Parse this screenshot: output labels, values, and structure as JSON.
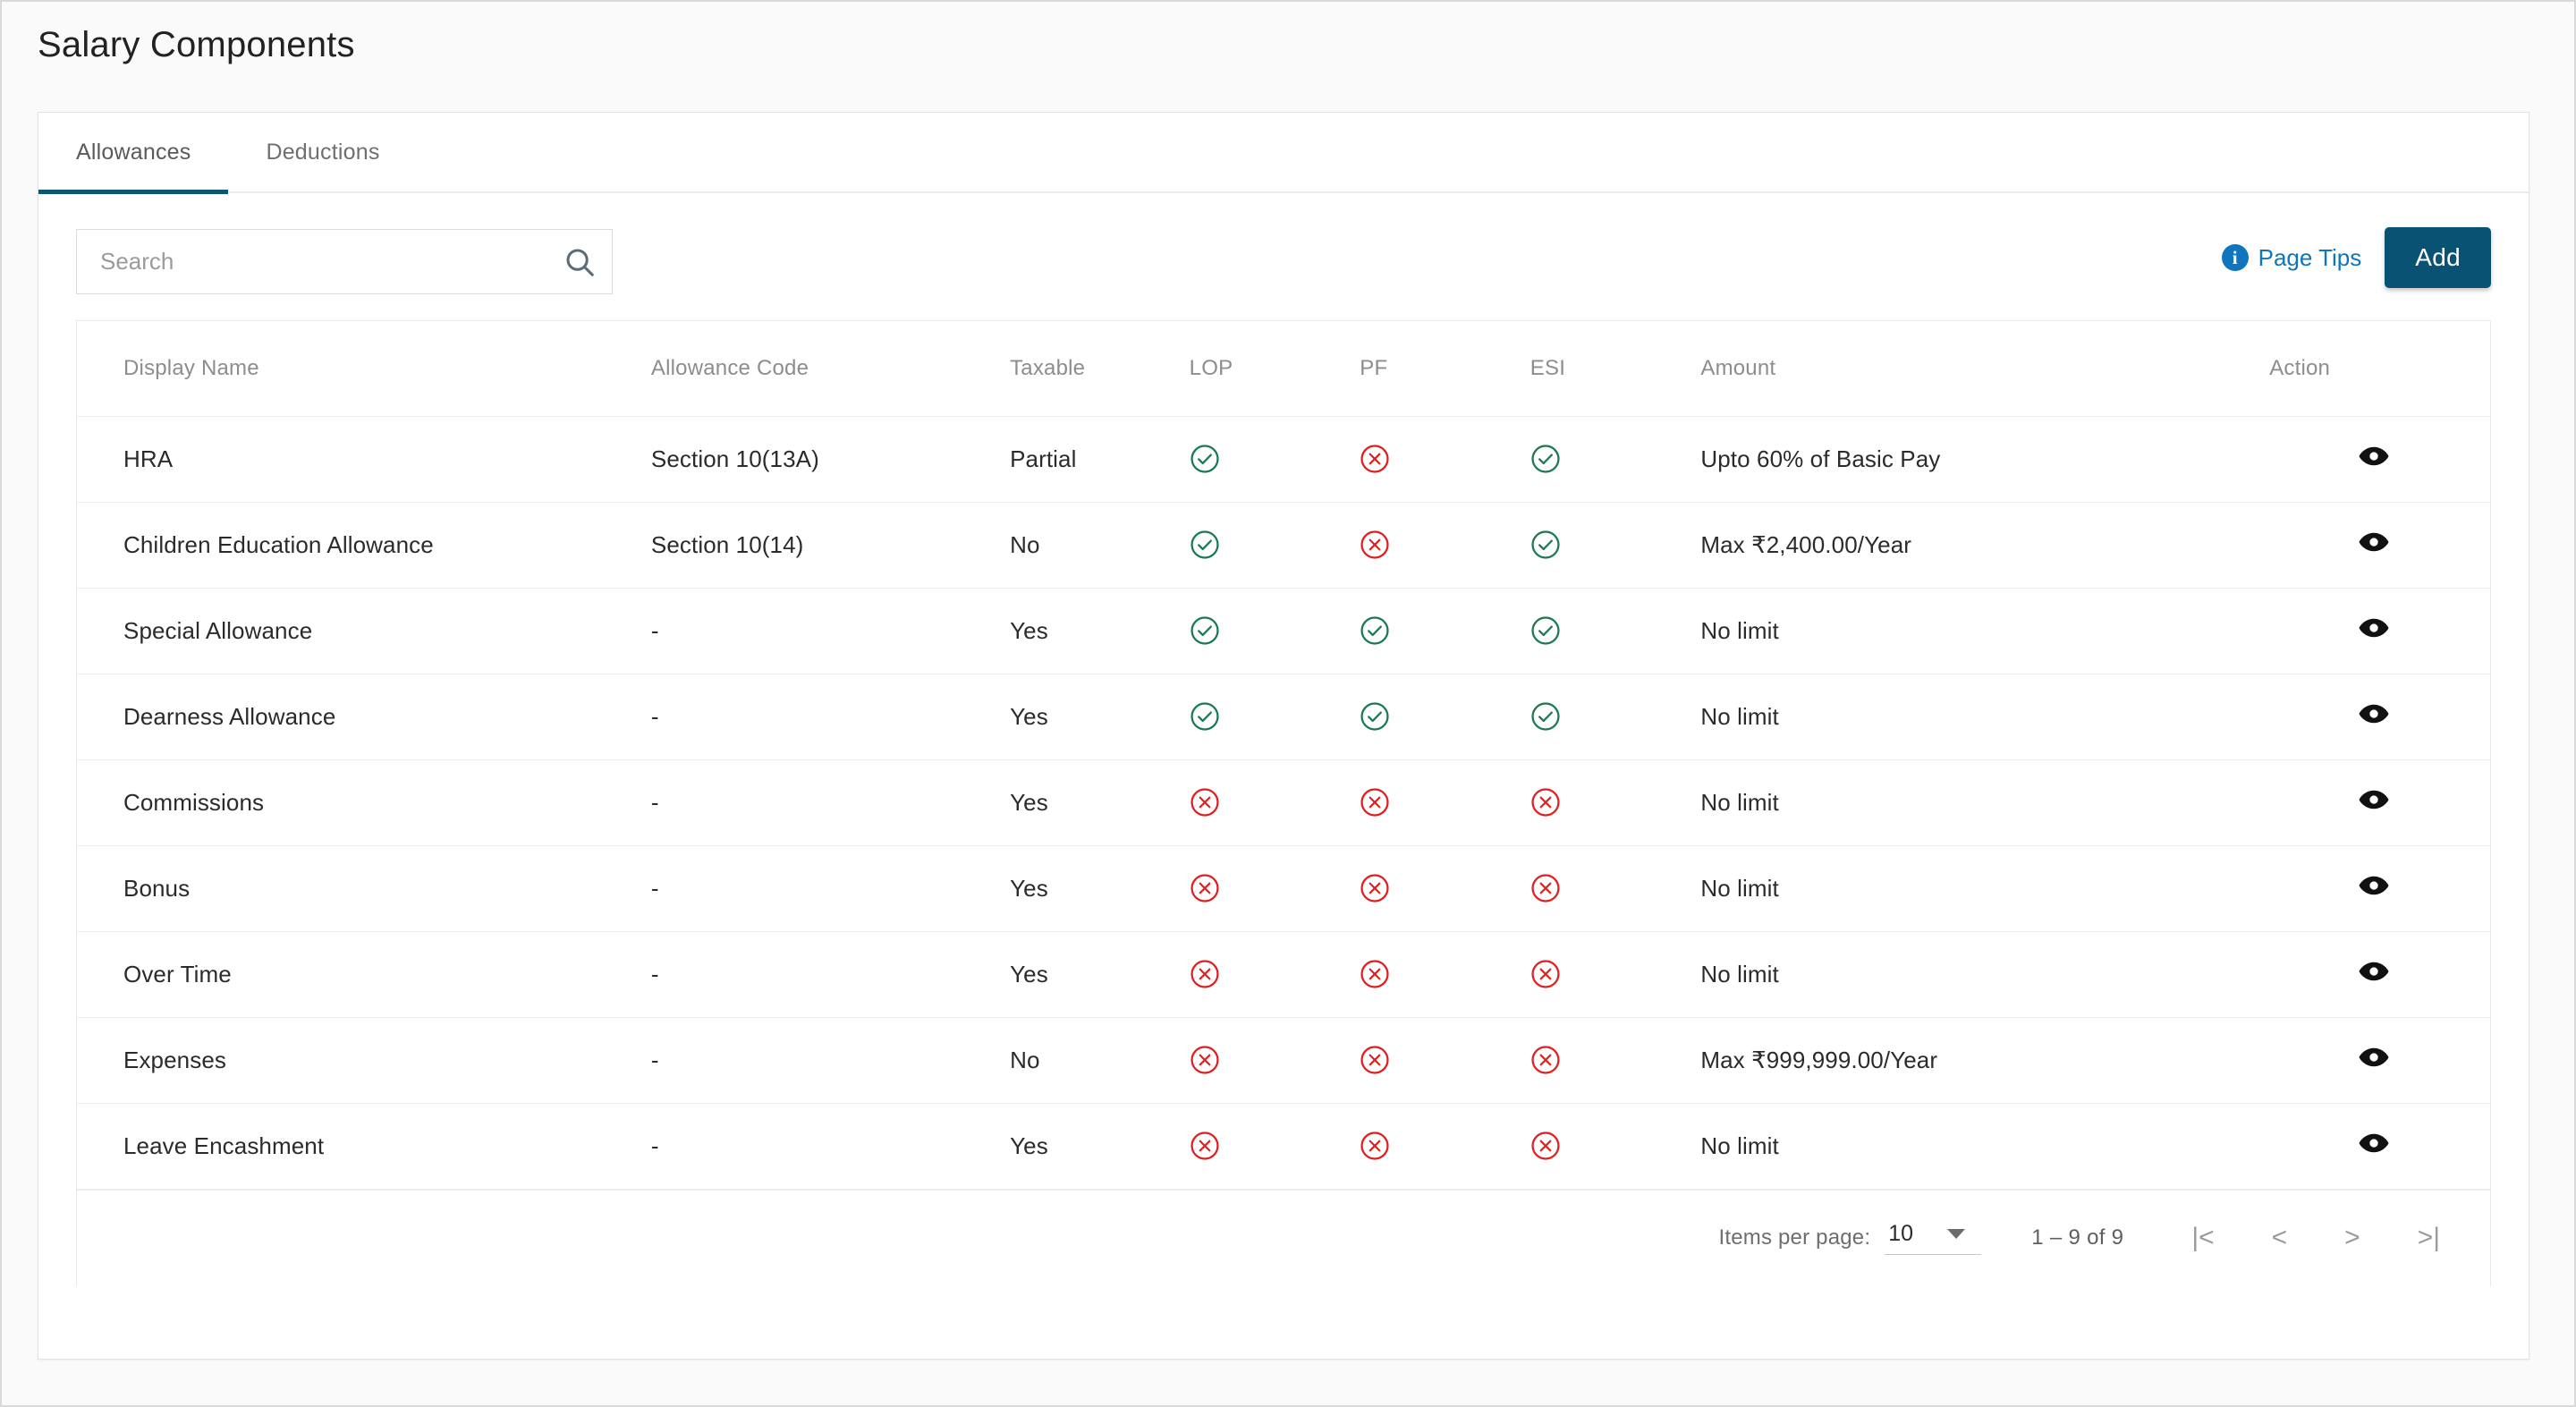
{
  "page": {
    "title": "Salary Components"
  },
  "tabs": [
    {
      "label": "Allowances",
      "active": true
    },
    {
      "label": "Deductions",
      "active": false
    }
  ],
  "toolbar": {
    "search_placeholder": "Search",
    "search_value": "",
    "search_icon": "search-icon",
    "page_tips_label": "Page Tips",
    "page_tips_icon": "info-icon",
    "add_label": "Add",
    "accent_color": "#0a5274",
    "link_color": "#1075bd"
  },
  "table": {
    "columns": [
      "Display Name",
      "Allowance Code",
      "Taxable",
      "LOP",
      "PF",
      "ESI",
      "Amount",
      "Action"
    ],
    "status_colors": {
      "yes": "#1b7a4f",
      "no": "#e02020"
    },
    "rows": [
      {
        "name": "HRA",
        "code": "Section 10(13A)",
        "taxable": "Partial",
        "lop": true,
        "pf": false,
        "esi": true,
        "amount": "Upto 60% of Basic Pay",
        "action_icon": "eye-icon"
      },
      {
        "name": "Children Education Allowance",
        "code": "Section 10(14)",
        "taxable": "No",
        "lop": true,
        "pf": false,
        "esi": true,
        "amount": "Max ₹2,400.00/Year",
        "action_icon": "eye-icon"
      },
      {
        "name": "Special Allowance",
        "code": "-",
        "taxable": "Yes",
        "lop": true,
        "pf": true,
        "esi": true,
        "amount": "No limit",
        "action_icon": "eye-icon"
      },
      {
        "name": "Dearness Allowance",
        "code": "-",
        "taxable": "Yes",
        "lop": true,
        "pf": true,
        "esi": true,
        "amount": "No limit",
        "action_icon": "eye-icon"
      },
      {
        "name": "Commissions",
        "code": "-",
        "taxable": "Yes",
        "lop": false,
        "pf": false,
        "esi": false,
        "amount": "No limit",
        "action_icon": "eye-icon"
      },
      {
        "name": "Bonus",
        "code": "-",
        "taxable": "Yes",
        "lop": false,
        "pf": false,
        "esi": false,
        "amount": "No limit",
        "action_icon": "eye-icon"
      },
      {
        "name": "Over Time",
        "code": "-",
        "taxable": "Yes",
        "lop": false,
        "pf": false,
        "esi": false,
        "amount": "No limit",
        "action_icon": "eye-icon"
      },
      {
        "name": "Expenses",
        "code": "-",
        "taxable": "No",
        "lop": false,
        "pf": false,
        "esi": false,
        "amount": "Max ₹999,999.00/Year",
        "action_icon": "eye-icon"
      },
      {
        "name": "Leave Encashment",
        "code": "-",
        "taxable": "Yes",
        "lop": false,
        "pf": false,
        "esi": false,
        "amount": "No limit",
        "action_icon": "eye-icon"
      }
    ]
  },
  "paginator": {
    "items_per_page_label": "Items per page:",
    "items_per_page_value": "10",
    "range_label": "1 – 9 of 9",
    "first_page_icon": "|<",
    "prev_page_icon": "<",
    "next_page_icon": ">",
    "last_page_icon": ">|"
  }
}
